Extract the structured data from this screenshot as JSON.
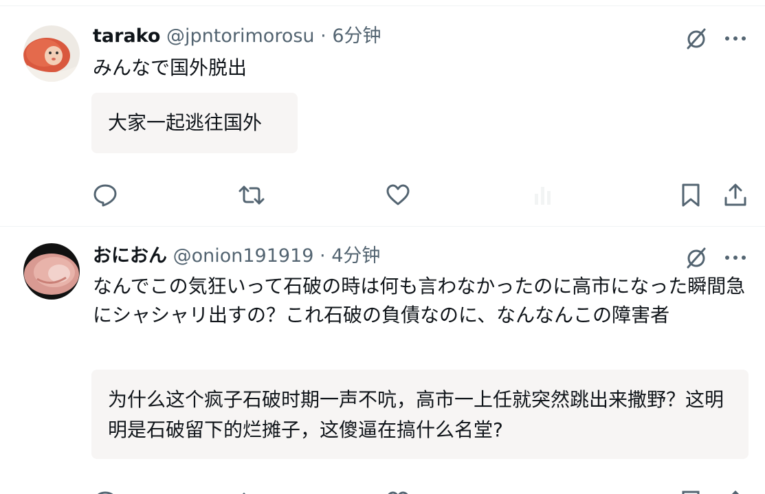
{
  "posts": [
    {
      "author_name": "tarako",
      "handle": "@jpntorimorosu",
      "separator": "·",
      "time": "6分钟",
      "text": "みんなで国外脱出",
      "translation": "大家一起逃往国外",
      "avatar_icon": "avatar-tarako",
      "actions": [
        "reply-icon",
        "repost-icon",
        "like-icon",
        "views-icon",
        "bookmark-icon",
        "share-icon"
      ]
    },
    {
      "author_name": "おにおん",
      "handle": "@onion191919",
      "separator": "·",
      "time": "4分钟",
      "text": "なんでこの気狂いって石破の時は何も言わなかったのに高市になった瞬間急にシャシャリ出すの？これ石破の負債なのに、なんなんこの障害者",
      "translation": "为什么这个疯子石破时期一声不吭，高市一上任就突然跳出来撒野？这明明是石破留下的烂摊子，这傻逼在搞什么名堂?",
      "avatar_icon": "avatar-onion",
      "actions": [
        "reply-icon",
        "repost-icon",
        "like-icon",
        "views-icon",
        "bookmark-icon",
        "share-icon"
      ]
    }
  ],
  "colors": {
    "text_primary": "#0f1419",
    "text_secondary": "#536471",
    "translation_bg": "#f7f5f4",
    "divider": "#eff3f4"
  }
}
